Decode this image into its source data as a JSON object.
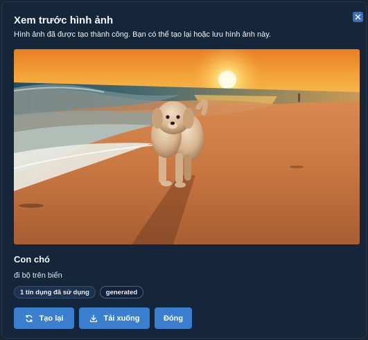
{
  "dialog": {
    "title": "Xem trước hình ảnh",
    "subtitle": "Hình ảnh đã được tạo thành công. Bạn có thể tạo lại hoặc lưu hình ảnh này."
  },
  "image": {
    "subject": "dog-walking-on-beach-at-sunset"
  },
  "caption": {
    "title": "Con chó",
    "description": "đi bộ trên biển"
  },
  "tags": [
    {
      "label": "1 tín dụng đã sử dụng"
    },
    {
      "label": "generated"
    }
  ],
  "actions": {
    "regenerate_label": "Tạo lại",
    "download_label": "Tải xuống",
    "close_label": "Đóng"
  },
  "icons": {
    "close": "close-icon",
    "regenerate": "refresh-icon",
    "download": "download-icon"
  },
  "colors": {
    "background": "#15263b",
    "accent": "#3a7fcf",
    "close_button": "#3b6fb8"
  }
}
